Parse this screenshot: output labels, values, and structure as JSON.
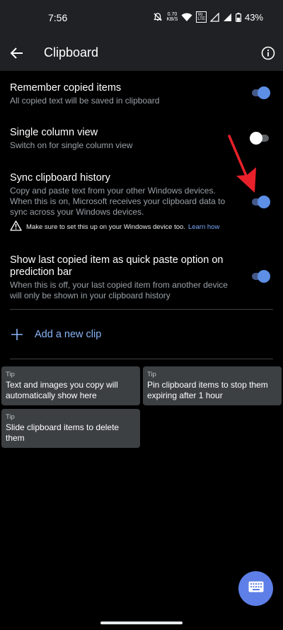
{
  "status_bar": {
    "time": "7:56",
    "speed_value": "0.70",
    "speed_unit": "KB/S",
    "volte_line1": "Vo",
    "volte_line2": "LTE",
    "battery": "43%"
  },
  "app_bar": {
    "title": "Clipboard"
  },
  "settings": [
    {
      "title": "Remember copied items",
      "subtitle": "All copied text will be saved in clipboard",
      "enabled": true
    },
    {
      "title": "Single column view",
      "subtitle": "Switch on for single column view",
      "enabled": false
    },
    {
      "title": "Sync clipboard history",
      "subtitle": "Copy and paste text from your other Windows devices. When this is on, Microsoft receives your clipboard data to sync across your Windows devices.",
      "enabled": true
    },
    {
      "title": "Show last copied item as quick paste option on prediction bar",
      "subtitle": "When this is off, your last copied item from another device will only be shown in your clipboard history",
      "enabled": true
    }
  ],
  "warning": {
    "text": "Make sure to set this up on your Windows device too.",
    "link": "Learn how"
  },
  "add_clip_label": "Add a new clip",
  "tips": [
    {
      "label": "Tip",
      "text": "Text and images you copy will automatically show here"
    },
    {
      "label": "Tip",
      "text": "Pin clipboard items to stop them expiring after 1 hour"
    },
    {
      "label": "Tip",
      "text": "Slide clipboard items to delete them"
    }
  ],
  "colors": {
    "accent": "#5d8fe6",
    "link": "#8ab4f8",
    "fab": "#5e7fe8",
    "annotation_arrow": "#e8202a"
  }
}
